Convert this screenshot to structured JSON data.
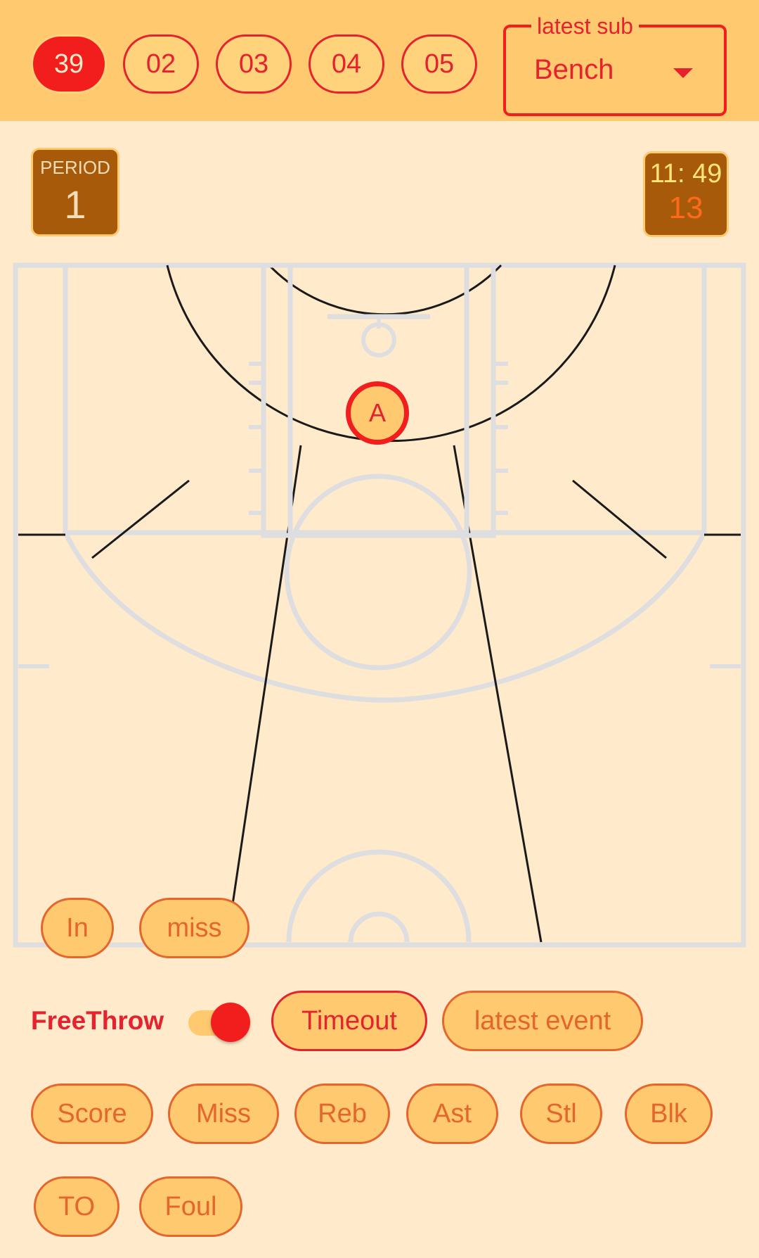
{
  "players": [
    "39",
    "02",
    "03",
    "04",
    "05"
  ],
  "substitution": {
    "label": "latest sub",
    "value": "Bench"
  },
  "period": {
    "label": "PERIOD",
    "value": "1"
  },
  "clock": {
    "time": "11: 49",
    "shot_clock": "13"
  },
  "court": {
    "marker_label": "A"
  },
  "shot_result": {
    "in": "In",
    "miss": "miss"
  },
  "controls": {
    "freethrow_label": "FreeThrow",
    "timeout": "Timeout",
    "latest_event": "latest event"
  },
  "stats": [
    "Score",
    "Miss",
    "Reb",
    "Ast",
    "Stl",
    "Blk",
    "TO",
    "Foul"
  ],
  "colors": {
    "header": "#FFC970",
    "background": "#FFEACB",
    "accent": "#E5222D",
    "active": "#F21D1D",
    "panel": "#A85A0B"
  }
}
